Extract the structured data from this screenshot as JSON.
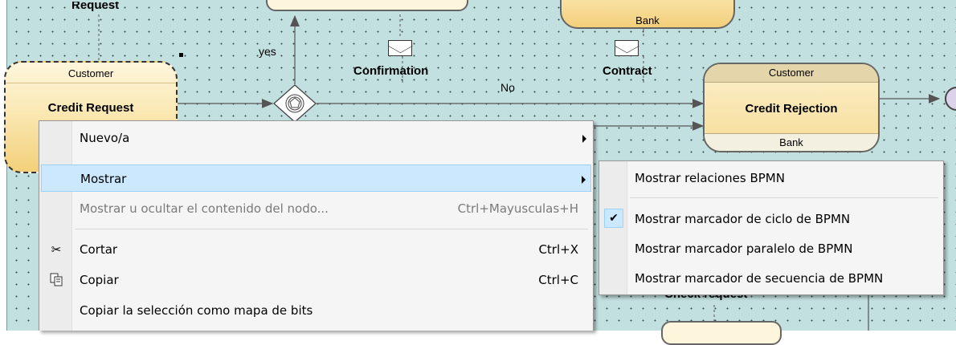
{
  "diagram": {
    "task_top_left_label": "Request",
    "bank_top": "Bank",
    "yes_label": "yes",
    "no_label": "No",
    "confirmation_label": "Confirmation",
    "contract_label": "Contract",
    "credit_request": {
      "top": "Customer",
      "name": "Credit Request"
    },
    "credit_rejection": {
      "top": "Customer",
      "name": "Credit Rejection",
      "bottom": "Bank"
    },
    "check_request_label": "Check request"
  },
  "context_menu": {
    "items": [
      {
        "label": "Nuevo/a",
        "submenu": true
      },
      {
        "label": "Mostrar",
        "submenu": true,
        "highlighted": true
      },
      {
        "label": "Mostrar u ocultar el contenido del nodo...",
        "shortcut": "Ctrl+Mayusculas+H",
        "disabled": true
      },
      {
        "label": "Cortar",
        "shortcut": "Ctrl+X",
        "icon": "scissors-icon"
      },
      {
        "label": "Copiar",
        "shortcut": "Ctrl+C",
        "icon": "copy-icon"
      },
      {
        "label": "Copiar la selección como mapa de bits"
      }
    ]
  },
  "submenu": {
    "items": [
      {
        "label": "Mostrar relaciones BPMN"
      },
      {
        "label": "Mostrar marcador de ciclo de BPMN",
        "checked": true
      },
      {
        "label": "Mostrar marcador paralelo de BPMN"
      },
      {
        "label": "Mostrar marcador de secuencia de BPMN"
      }
    ]
  },
  "colors": {
    "canvas_bg": "#c3e0e0",
    "menu_highlight": "#cce8ff",
    "menu_highlight_border": "#99d1ff"
  }
}
